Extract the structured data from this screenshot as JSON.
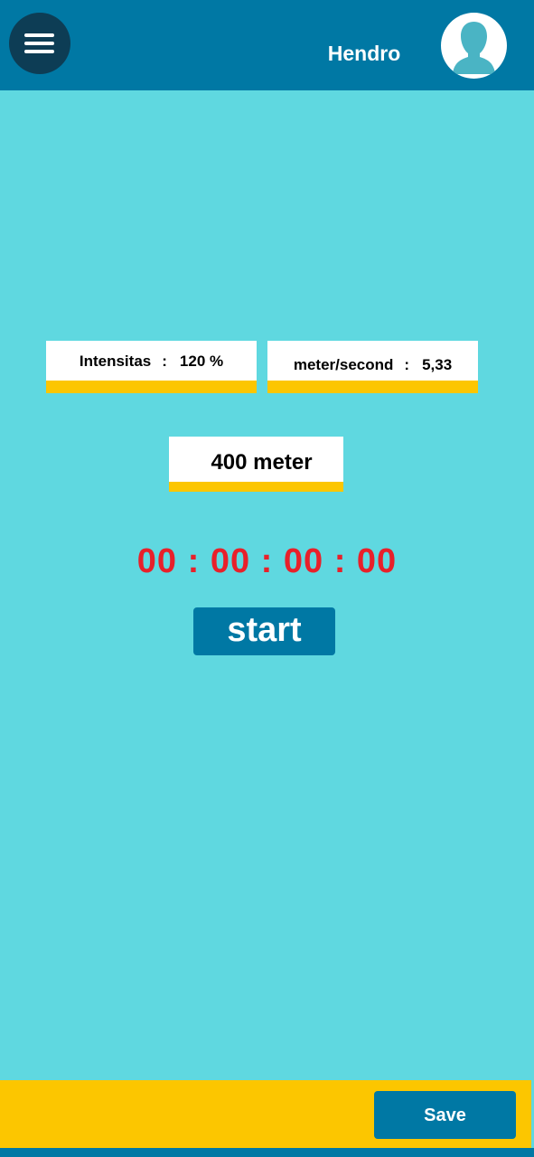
{
  "header": {
    "menu_icon": "hamburger-menu-icon",
    "username": "Hendro",
    "avatar_icon": "user-silhouette-icon"
  },
  "stats": {
    "intensity_label": "Intensitas",
    "intensity_separator": ":",
    "intensity_value": "120 %",
    "speed_label": "meter/second",
    "speed_separator": ":",
    "speed_value": "5,33"
  },
  "distance": "400 meter",
  "timer": "00 : 00 : 00 : 00",
  "start_label": "start",
  "save_label": "Save",
  "colors": {
    "background": "#5fd8e0",
    "primary": "#0078a4",
    "accent": "#fcc600",
    "timer_red": "#e8202a",
    "menu_dark": "#0d3d55"
  }
}
